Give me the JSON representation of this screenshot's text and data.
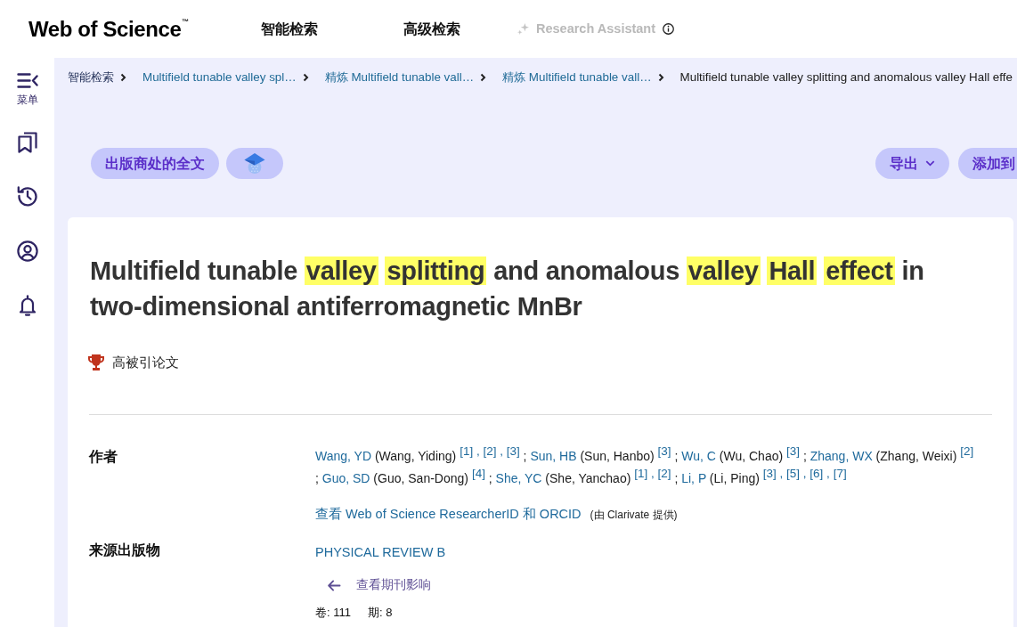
{
  "header": {
    "logo": {
      "text": "Web of Science",
      "trademark": "™"
    },
    "nav": [
      {
        "kind": "link",
        "label": "智能检索",
        "disabled": false
      },
      {
        "kind": "link",
        "label": "高级检索",
        "disabled": false
      },
      {
        "kind": "assistant",
        "label": "Research Assistant",
        "disabled": true
      }
    ]
  },
  "sidebar": {
    "items": [
      {
        "kind": "menu",
        "label": "菜单"
      },
      {
        "kind": "bookmarks"
      },
      {
        "kind": "history"
      },
      {
        "kind": "profile"
      },
      {
        "kind": "alerts"
      }
    ]
  },
  "breadcrumb": [
    {
      "kind": "root",
      "label": "智能检索"
    },
    {
      "kind": "link",
      "label": "Multifield tunable valley spl…"
    },
    {
      "kind": "link",
      "label": "精炼 Multifield tunable vall…"
    },
    {
      "kind": "link",
      "label": "精炼 Multifield tunable vall…"
    },
    {
      "kind": "current",
      "label": "Multifield tunable valley splitting and anomalous valley Hall effe"
    }
  ],
  "toolbar": {
    "left": [
      {
        "kind": "text",
        "label": "出版商处的全文"
      },
      {
        "kind": "icon"
      }
    ],
    "right": [
      {
        "kind": "dropdown",
        "label": "导出"
      },
      {
        "kind": "text",
        "label": "添加到"
      }
    ]
  },
  "record": {
    "title": [
      {
        "text": "Multifield tunable",
        "highlighted": false
      },
      {
        "text": "valley",
        "highlighted": true
      },
      {
        "text": "splitting",
        "highlighted": true
      },
      {
        "text": "and anomalous",
        "highlighted": false
      },
      {
        "text": "valley",
        "highlighted": true
      },
      {
        "text": "Hall",
        "highlighted": true
      },
      {
        "text": "effect",
        "highlighted": true
      },
      {
        "text": "in two-dimensional antiferromagnetic MnBr",
        "highlighted": false
      }
    ],
    "badge": {
      "label": "高被引论文"
    },
    "fields": [
      {
        "kind": "authors",
        "label": "作者",
        "author_separator": ";",
        "ref_separator": ",",
        "authors": [
          {
            "short": "Wang, YD",
            "full": "(Wang, Yiding)",
            "refs": [
              "[1]",
              "[2]",
              "[3]"
            ]
          },
          {
            "short": "Sun, HB",
            "full": "(Sun, Hanbo)",
            "refs": [
              "[3]"
            ]
          },
          {
            "short": "Wu, C",
            "full": "(Wu, Chao)",
            "refs": [
              "[3]"
            ]
          },
          {
            "short": "Zhang, WX",
            "full": "(Zhang, Weixi)",
            "refs": [
              "[2]"
            ]
          },
          {
            "short": "Guo, SD",
            "full": "(Guo, San-Dong)",
            "refs": [
              "[4]"
            ]
          },
          {
            "short": "She, YC",
            "full": "(She, Yanchao)",
            "refs": [
              "[1]",
              "[2]"
            ]
          },
          {
            "short": "Li, P",
            "full": "(Li, Ping)",
            "refs": [
              "[3]",
              "[5]",
              "[6]",
              "[7]"
            ]
          }
        ],
        "profile_link": "查看 Web of Science ResearcherID 和 ORCID",
        "profile_note": "(由 Clarivate 提供)"
      },
      {
        "kind": "source",
        "label": "来源出版物",
        "journal": "PHYSICAL REVIEW B",
        "impact_link": "查看期刊影响",
        "volume": "卷: 111",
        "issue": "期: 8"
      }
    ]
  }
}
